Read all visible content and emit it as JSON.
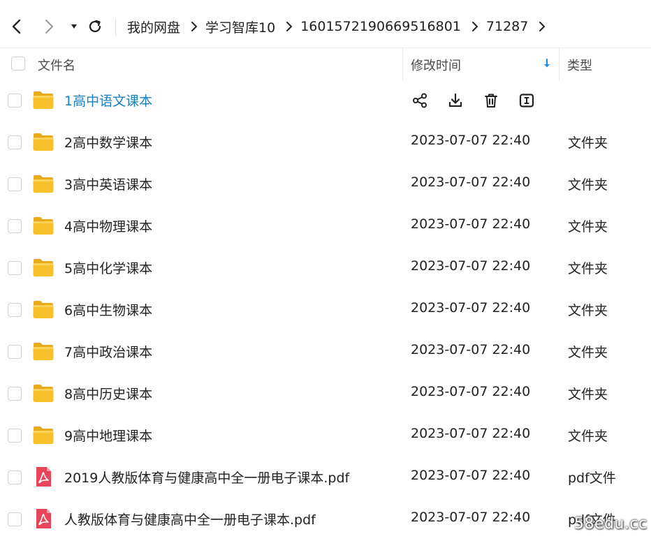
{
  "breadcrumb": {
    "items": [
      "我的网盘",
      "学习智库10",
      "1601572190669516801",
      "71287"
    ]
  },
  "header": {
    "name_label": "文件名",
    "time_label": "修改时间",
    "type_label": "类型"
  },
  "files": [
    {
      "name": "1高中语文课本",
      "time": "",
      "type": "",
      "icon": "folder-icon"
    },
    {
      "name": "2高中数学课本",
      "time": "2023-07-07 22:40",
      "type": "文件夹",
      "icon": "folder-icon"
    },
    {
      "name": "3高中英语课本",
      "time": "2023-07-07 22:40",
      "type": "文件夹",
      "icon": "folder-icon"
    },
    {
      "name": "4高中物理课本",
      "time": "2023-07-07 22:40",
      "type": "文件夹",
      "icon": "folder-icon"
    },
    {
      "name": "5高中化学课本",
      "time": "2023-07-07 22:40",
      "type": "文件夹",
      "icon": "folder-icon"
    },
    {
      "name": "6高中生物课本",
      "time": "2023-07-07 22:40",
      "type": "文件夹",
      "icon": "folder-icon"
    },
    {
      "name": "7高中政治课本",
      "time": "2023-07-07 22:40",
      "type": "文件夹",
      "icon": "folder-icon"
    },
    {
      "name": "8高中历史课本",
      "time": "2023-07-07 22:40",
      "type": "文件夹",
      "icon": "folder-icon"
    },
    {
      "name": "9高中地理课本",
      "time": "2023-07-07 22:40",
      "type": "文件夹",
      "icon": "folder-icon"
    },
    {
      "name": "2019人教版体育与健康高中全一册电子课本.pdf",
      "time": "2023-07-07 22:40",
      "type": "pdf文件",
      "icon": "pdf-icon"
    },
    {
      "name": "人教版体育与健康高中全一册电子课本.pdf",
      "time": "2023-07-07 22:40",
      "type": "pdf文件",
      "icon": "pdf-icon"
    }
  ],
  "watermark": "58edu.cc",
  "colors": {
    "accent": "#1a7fc0",
    "folder": "#f7c12c",
    "pdf": "#e8455a",
    "sort_arrow": "#1a8ee8"
  }
}
